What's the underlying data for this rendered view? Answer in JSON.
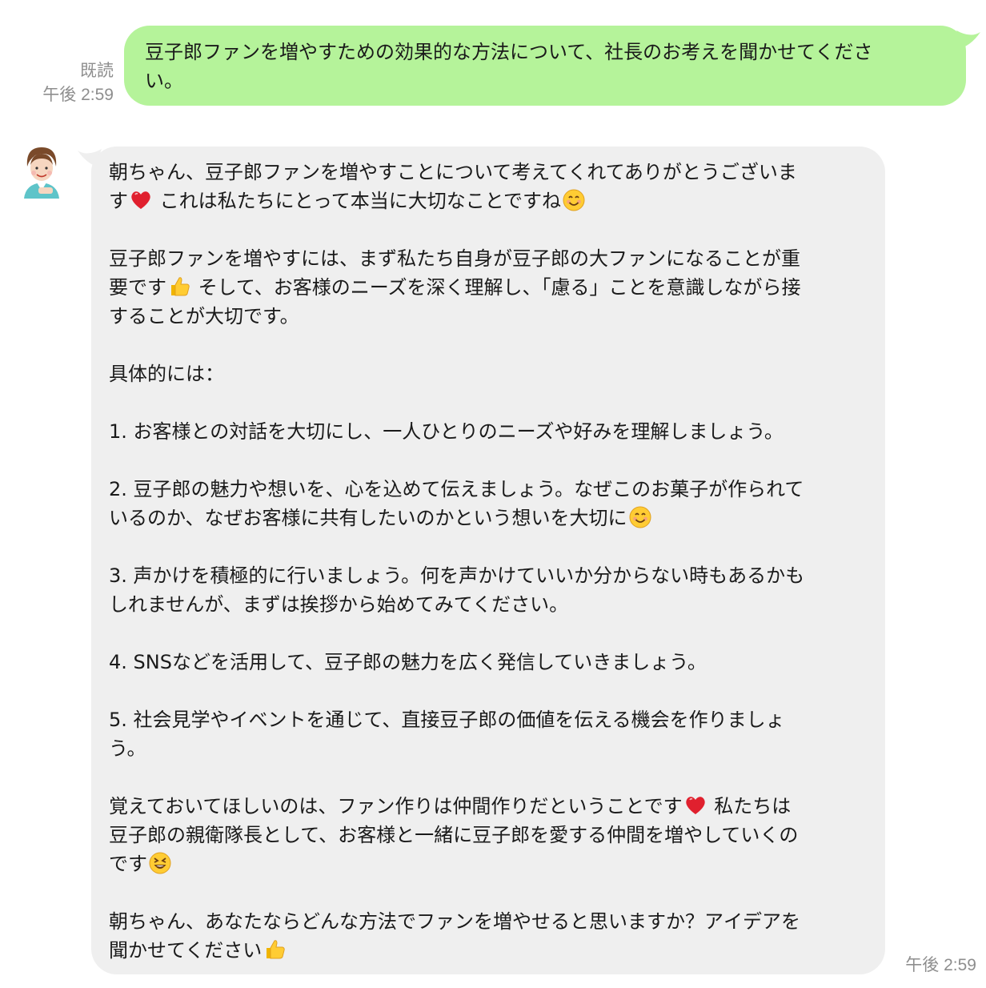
{
  "sent": {
    "read_label": "既読",
    "time": "午後 2:59",
    "text": "豆子郎ファンを増やすための効果的な方法について、社長のお考えを聞かせてくださ\nい。"
  },
  "received": {
    "time": "午後 2:59",
    "paragraphs": [
      [
        "朝ちゃん、豆子郎ファンを増やすことについて考えてくれてありがとうございま\nす",
        "heart-icon",
        " これは私たちにとって本当に大切なことですね",
        "smile-icon"
      ],
      [
        "豆子郎ファンを増やすには、まず私たち自身が豆子郎の大ファンになることが重\n要です",
        "thumbs-up-icon",
        " そして、お客様のニーズを深く理解し、「慮る」ことを意識しながら接\nすることが大切です。"
      ],
      [
        "具体的には："
      ],
      [
        "1. お客様との対話を大切にし、一人ひとりのニーズや好みを理解しましょう。"
      ],
      [
        "2. 豆子郎の魅力や想いを、心を込めて伝えましょう。なぜこのお菓子が作られて\nいるのか、なぜお客様に共有したいのかという想いを大切に",
        "smile-icon"
      ],
      [
        "3. 声かけを積極的に行いましょう。何を声かけていいか分からない時もあるかも\nしれませんが、まずは挨拶から始めてみてください。"
      ],
      [
        "4. SNSなどを活用して、豆子郎の魅力を広く発信していきましょう。"
      ],
      [
        "5. 社会見学やイベントを通じて、直接豆子郎の価値を伝える機会を作りましょ\nう。"
      ],
      [
        "覚えておいてほしいのは、ファン作りは仲間作りだということです",
        "heart-icon",
        " 私たちは\n豆子郎の親衛隊長として、お客様と一緒に豆子郎を愛する仲間を増やしていくの\nです",
        "grin-squint-icon"
      ],
      [
        "朝ちゃん、あなたならどんな方法でファンを増やせると思いますか？アイデアを\n聞かせてください",
        "thumbs-up-icon"
      ]
    ]
  },
  "colors": {
    "sent_bubble": "#b5f39a",
    "received_bubble": "#efefef",
    "meta_text": "#8e8e8e"
  }
}
